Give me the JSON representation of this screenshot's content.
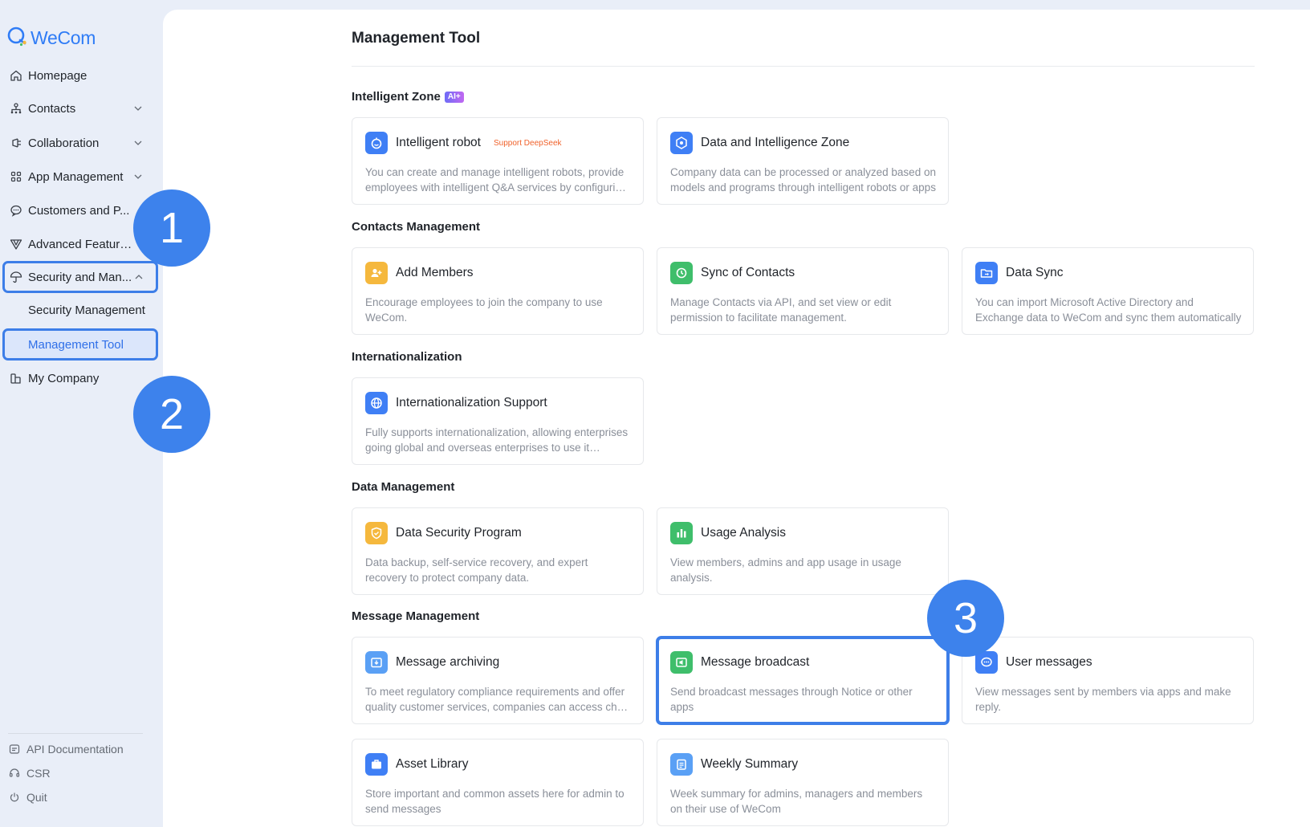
{
  "app": {
    "name": "WeCom"
  },
  "sidebar": {
    "items": [
      {
        "label": "Homepage",
        "icon": "home-icon"
      },
      {
        "label": "Contacts",
        "icon": "org-chart-icon"
      },
      {
        "label": "Collaboration",
        "icon": "collaboration-icon"
      },
      {
        "label": "App Management",
        "icon": "apps-grid-icon"
      },
      {
        "label": "Customers and P...",
        "icon": "chat-bubble-icon"
      },
      {
        "label": "Advanced Features",
        "icon": "advanced-icon"
      },
      {
        "label": "Security and Man...",
        "icon": "umbrella-icon"
      },
      {
        "label": "My Company",
        "icon": "building-icon"
      }
    ],
    "sub_items": [
      {
        "label": "Security Management"
      },
      {
        "label": "Management Tool"
      }
    ],
    "footer": [
      {
        "label": "API Documentation",
        "icon": "document-icon"
      },
      {
        "label": "CSR",
        "icon": "headset-icon"
      },
      {
        "label": "Quit",
        "icon": "power-icon"
      }
    ]
  },
  "badges": [
    "1",
    "2",
    "3"
  ],
  "main": {
    "title": "Management Tool",
    "sections": [
      {
        "title": "Intelligent Zone",
        "tag": "AI+",
        "cards": [
          {
            "name": "Intelligent robot",
            "tag": "Support DeepSeek",
            "desc": "You can create and manage intelligent robots, provide employees with intelligent Q&A services by configuring knowledge bases",
            "color": "#3f7ff5"
          },
          {
            "name": "Data and Intelligence Zone",
            "desc": "Company data can be processed or analyzed based on models and programs through intelligent robots or apps",
            "color": "#3f7ff5"
          }
        ]
      },
      {
        "title": "Contacts Management",
        "cards": [
          {
            "name": "Add Members",
            "desc": "Encourage employees to join the company to use WeCom.",
            "color": "#f5b83d"
          },
          {
            "name": "Sync of Contacts",
            "desc": "Manage Contacts via API, and set view or edit permission to facilitate management.",
            "color": "#3fbe6b"
          },
          {
            "name": "Data Sync",
            "desc": "You can import Microsoft Active Directory and Exchange data to WeCom and sync them automatically",
            "color": "#3f7ff5"
          }
        ]
      },
      {
        "title": "Internationalization",
        "cards": [
          {
            "name": "Internationalization Support",
            "desc": "Fully supports internationalization, allowing enterprises going global and overseas enterprises to use it smoothly",
            "color": "#3f7ff5"
          }
        ]
      },
      {
        "title": "Data Management",
        "cards": [
          {
            "name": "Data Security Program",
            "desc": "Data backup, self-service recovery, and expert recovery to protect company data.",
            "color": "#f5b83d"
          },
          {
            "name": "Usage Analysis",
            "desc": "View members, admins and app usage in usage analysis.",
            "color": "#3fbe6b"
          }
        ]
      },
      {
        "title": "Message Management",
        "cards": [
          {
            "name": "Message archiving",
            "desc": "To meet regulatory compliance requirements and offer quality customer services, companies can access chat records",
            "color": "#5aa0f5"
          },
          {
            "name": "Message broadcast",
            "desc": "Send broadcast messages through Notice or other apps",
            "color": "#3fbe6b"
          },
          {
            "name": "User messages",
            "desc": "View messages sent by members via apps and make reply.",
            "color": "#3f7ff5"
          }
        ]
      },
      {
        "title": "",
        "cards": [
          {
            "name": "Asset Library",
            "desc": "Store important and common assets here for admin to send messages",
            "color": "#3f7ff5"
          },
          {
            "name": "Weekly Summary",
            "desc": "Week summary for admins, managers and members on their use of WeCom",
            "color": "#5aa0f5"
          }
        ]
      }
    ]
  }
}
